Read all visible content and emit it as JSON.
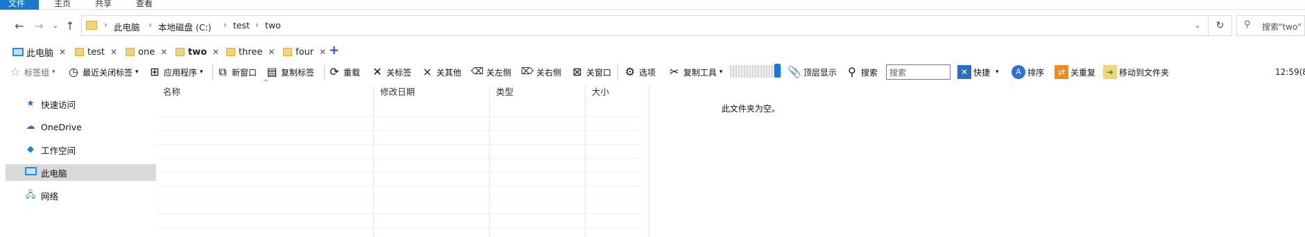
{
  "ribbon": {
    "tabs": [
      {
        "label": "文件",
        "active": true
      },
      {
        "label": "主页",
        "active": false
      },
      {
        "label": "共享",
        "active": false
      },
      {
        "label": "查看",
        "active": false
      }
    ]
  },
  "address": {
    "crumbs": [
      "此电脑",
      "本地磁盘 (C:)",
      "test",
      "two"
    ],
    "search_placeholder": "搜索\"two\""
  },
  "tabs": [
    {
      "label": "此电脑",
      "icon": "computer-icon",
      "active": false
    },
    {
      "label": "test",
      "icon": "folder-icon",
      "active": false
    },
    {
      "label": "one",
      "icon": "folder-icon",
      "active": false
    },
    {
      "label": "two",
      "icon": "folder-icon",
      "active": true
    },
    {
      "label": "three",
      "icon": "folder-icon",
      "active": false
    },
    {
      "label": "four",
      "icon": "folder-icon",
      "active": false
    }
  ],
  "toolbar": {
    "bookmark_group": "标签组",
    "recent_closed": "最近关闭标签",
    "apps": "应用程序",
    "new_window": "新窗口",
    "copy_tab": "复制标签",
    "reload": "重载",
    "close_tab": "关标签",
    "close_others": "关其他",
    "close_left": "关左侧",
    "close_right": "关右侧",
    "close_window": "关窗口",
    "options": "选项",
    "copy_tools": "复制工具",
    "top_display": "顶层显示",
    "search_label": "搜索",
    "search_input": "搜索",
    "quick": "快捷",
    "sort": "排序",
    "close_duplicates": "关重复",
    "move_to_folder": "移动到文件夹",
    "clock": "12:59(8"
  },
  "navpane": {
    "items": [
      {
        "label": "快速访问",
        "icon": "star-icon",
        "selected": false
      },
      {
        "label": "OneDrive",
        "icon": "cloud-icon",
        "selected": false
      },
      {
        "label": "工作空间",
        "icon": "workspace-icon",
        "selected": false
      },
      {
        "label": "此电脑",
        "icon": "computer-icon",
        "selected": true
      },
      {
        "label": "网络",
        "icon": "network-icon",
        "selected": false
      }
    ]
  },
  "filelist": {
    "columns": [
      "名称",
      "修改日期",
      "类型",
      "大小"
    ],
    "empty_message": "此文件夹为空。"
  },
  "colors": {
    "accent": "#1979ca",
    "selected_bg": "#d9d9d9",
    "folder": "#f3d27a"
  }
}
